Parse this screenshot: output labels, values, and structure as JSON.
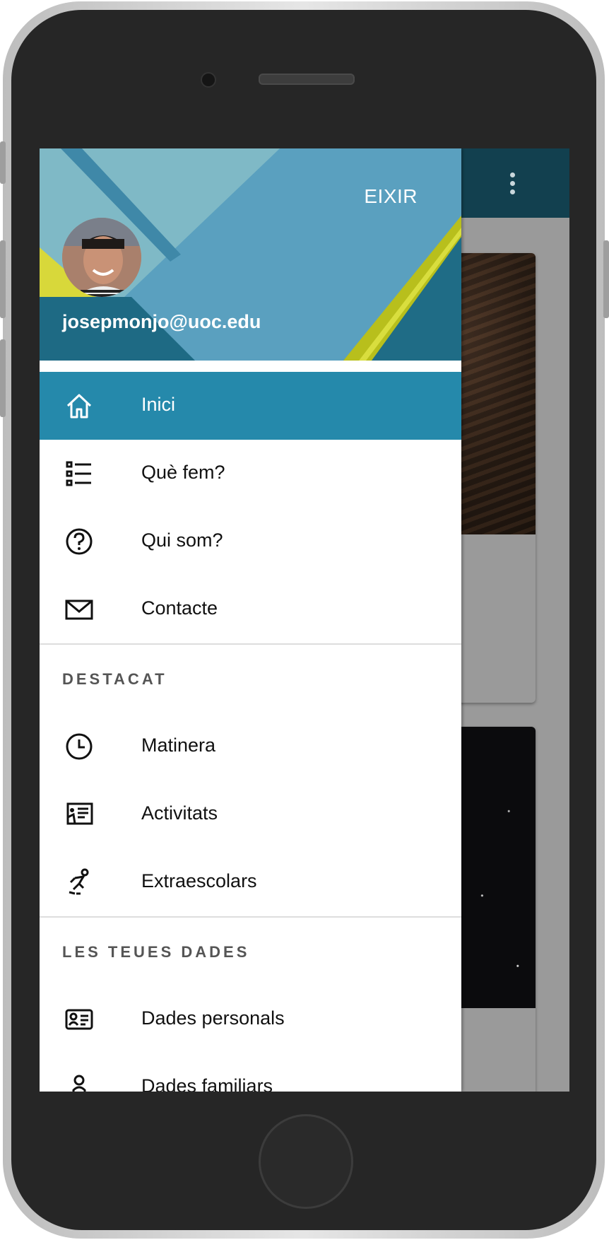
{
  "app": {
    "accent": "#2589ab",
    "toolbar_color": "#12404f"
  },
  "header": {
    "logout_label": "EIXIR",
    "email": "josepmonjo@uoc.edu"
  },
  "menu": {
    "main": [
      {
        "label": "Inici",
        "icon": "home-icon",
        "active": true
      },
      {
        "label": "Què fem?",
        "icon": "list-icon",
        "active": false
      },
      {
        "label": "Qui som?",
        "icon": "help-circle-icon",
        "active": false
      },
      {
        "label": "Contacte",
        "icon": "mail-icon",
        "active": false
      }
    ],
    "sections": [
      {
        "title": "DESTACAT",
        "items": [
          {
            "label": "Matinera",
            "icon": "clock-icon"
          },
          {
            "label": "Activitats",
            "icon": "presentation-icon"
          },
          {
            "label": "Extraescolars",
            "icon": "skating-icon"
          }
        ]
      },
      {
        "title": "LES TEUES DADES",
        "items": [
          {
            "label": "Dades personals",
            "icon": "id-card-icon"
          },
          {
            "label": "Dades familiars",
            "icon": "person-icon"
          }
        ]
      }
    ]
  }
}
